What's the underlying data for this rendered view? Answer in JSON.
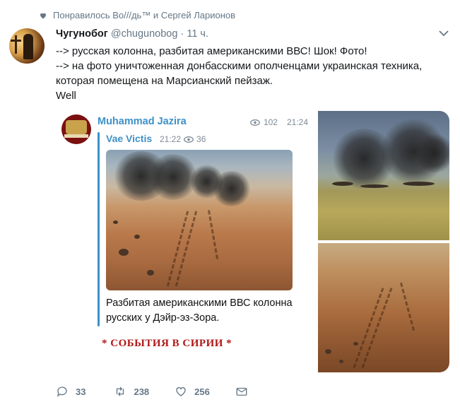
{
  "liked_by": {
    "text": "Понравилось Во///дь™ и Сергей Ларионов"
  },
  "tweet": {
    "name": "Чугунобог",
    "handle": "@chugunobog",
    "separator": "·",
    "time": "11 ч.",
    "lines": [
      "--> русская колонна, разбитая американскими ВВС! Шок! Фото!",
      "--> на фото уничтоженная донбасскими ополченцами украинская техника,",
      "которая помещена на Марсианский пейзаж.",
      "Well"
    ]
  },
  "telegram": {
    "channel": "Muhammad Jazira",
    "views": "102",
    "time": "21:24",
    "forward": {
      "name": "Vae Victis",
      "time": "21:22",
      "views": "36"
    },
    "caption": "Разбитая американскими ВВС колонна русских у Дэйр-эз-Зора.",
    "signature": "* СОБЫТИЯ В СИРИИ *"
  },
  "actions": {
    "replies": "33",
    "retweets": "238",
    "likes": "256"
  },
  "colors": {
    "link_blue": "#3d90c8",
    "muted": "#657786",
    "signature_red": "#b01818"
  }
}
